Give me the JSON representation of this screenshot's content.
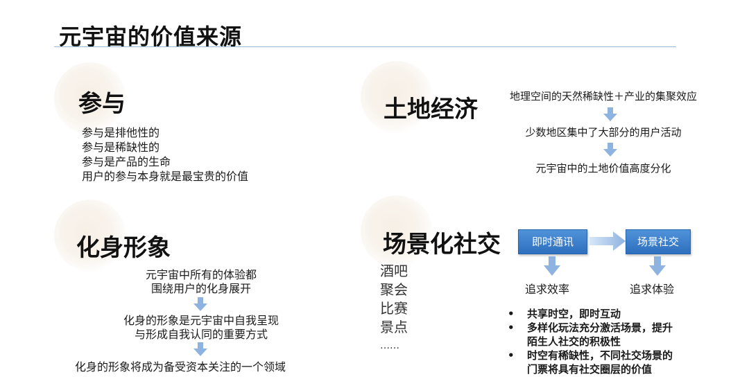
{
  "page": {
    "title": "元宇宙的价值来源"
  },
  "participation": {
    "heading": "参与",
    "lines": [
      "参与是排他性的",
      "参与是稀缺性的",
      "参与是产品的生命",
      "用户的参与本身就是最宝贵的价值"
    ]
  },
  "land": {
    "heading": "土地经济",
    "flow": [
      "地理空间的天然稀缺性＋产业的集聚效应",
      "少数地区集中了大部分的用户活动",
      "元宇宙中的土地价值高度分化"
    ]
  },
  "avatar": {
    "heading": "化身形象",
    "step1": [
      "元宇宙中所有的体验都",
      "围绕用户的化身展开"
    ],
    "step2": [
      "化身的形象是元宇宙中自我呈现",
      "与形成自我认同的重要方式"
    ],
    "step3": "化身的形象将成为备受资本关注的一个领域"
  },
  "social": {
    "heading": "场景化社交",
    "scenes": [
      "酒吧",
      "聚会",
      "比赛",
      "景点",
      "……"
    ],
    "box_left": "即时通讯",
    "box_right": "场景社交",
    "pursuit_left": "追求效率",
    "pursuit_right": "追求体验",
    "bullets": [
      [
        "共享时空，即时互动"
      ],
      [
        "多样化玩法充分激活场景，提升",
        "陌生人社交的积极性"
      ],
      [
        "时空有稀缺性，不同社交场景的",
        "门票将具有社交圈层的价值"
      ]
    ]
  }
}
